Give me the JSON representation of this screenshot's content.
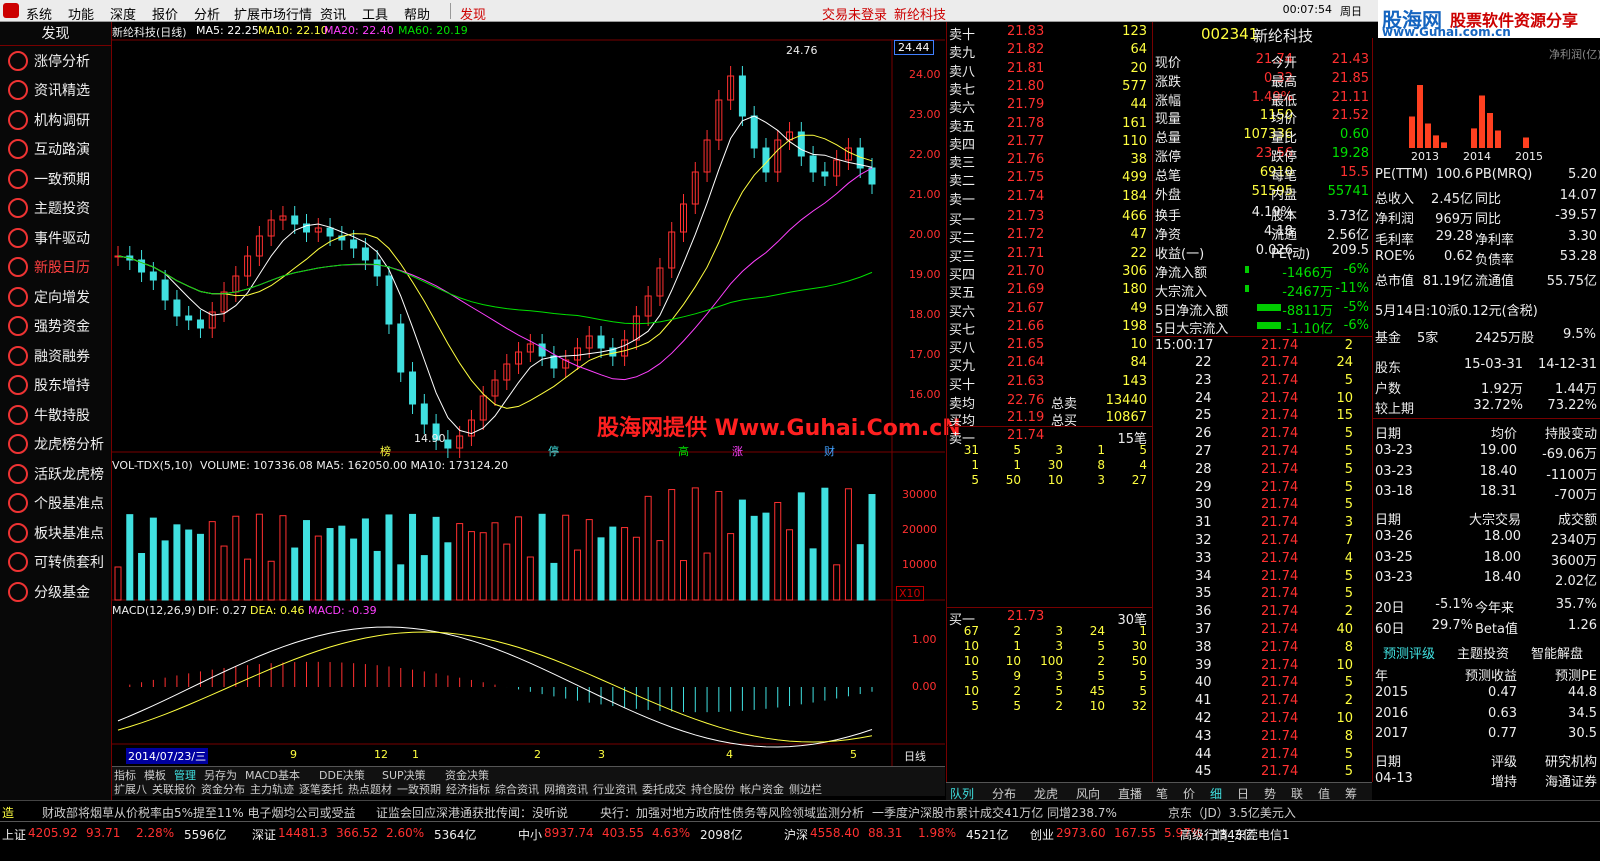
{
  "menu": [
    "系统",
    "功能",
    "深度",
    "报价",
    "分析",
    "扩展市场行情",
    "资讯",
    "工具",
    "帮助",
    "发现"
  ],
  "menu_status": {
    "login": "交易未登录",
    "stock": "新纶科技"
  },
  "clock": "00:07:54",
  "weekday": "周日",
  "brand": {
    "name": "股海网",
    "slogan": "股票软件资源分享",
    "url": "www.Guhai.com.cn"
  },
  "sidebar": {
    "header": "发现",
    "items": [
      "涨停分析",
      "资讯精选",
      "机构调研",
      "互动路演",
      "一致预期",
      "主题投资",
      "事件驱动",
      "新股日历",
      "定向增发",
      "强势资金",
      "融资融券",
      "股东增持",
      "牛散持股",
      "龙虎榜分析",
      "活跃龙虎榜",
      "个股基准点",
      "板块基准点",
      "可转债套利",
      "分级基金"
    ]
  },
  "chart": {
    "title": "新纶科技(日线)",
    "ma": [
      {
        "label": "MA5: 22.25",
        "color": "#ffffff"
      },
      {
        "label": "MA10: 22.10",
        "color": "#ffff40"
      },
      {
        "label": "MA20: 22.40",
        "color": "#ff40ff"
      },
      {
        "label": "MA60: 20.19",
        "color": "#00e000"
      }
    ],
    "price_axis": [
      "24.00",
      "23.00",
      "22.00",
      "21.00",
      "20.00",
      "19.00",
      "18.00",
      "17.00",
      "16.00"
    ],
    "current": "24.44",
    "high_label": "24.76",
    "low_label": "14.90",
    "markers": [
      {
        "t": "榜",
        "c": "#ffff40"
      },
      {
        "t": "停",
        "c": "#40e0e0"
      },
      {
        "t": "高",
        "c": "#00e000"
      },
      {
        "t": "涨",
        "c": "#ff40ff"
      },
      {
        "t": "财",
        "c": "#40a0ff"
      }
    ],
    "volume_title": "VOL-TDX(5,10)",
    "volume_values": "VOLUME: 107336.08  MA5: 162050.00  MA10: 173124.20",
    "vol_axis": [
      "30000",
      "20000",
      "10000"
    ],
    "vol_unit": "X10",
    "macd_title": "MACD(12,26,9)",
    "macd_dif": "DIF: 0.27",
    "macd_dea": "DEA: 0.46",
    "macd_val": "MACD: -0.39",
    "macd_axis": [
      "1.00",
      "0.00"
    ],
    "date_label": "2014/07/23/三",
    "x_ticks": [
      "9",
      "12",
      "1",
      "2",
      "3",
      "4",
      "5"
    ],
    "period": "日线",
    "zoom": [
      "+",
      "-",
      "0"
    ],
    "tabs": [
      "指标",
      "模板",
      "管理",
      "另存为",
      "MACD基本",
      "DDE决策",
      "SUP决策",
      "资金决策"
    ],
    "tabs2": [
      "扩展八",
      "关联报价",
      "资金分布",
      "主力轨迹",
      "逐笔委托",
      "热点题材",
      "一致预期",
      "经济指标",
      "综合资讯",
      "网摘资讯",
      "行业资讯",
      "委托成交",
      "持仓股份",
      "帐户资金",
      "侧边栏"
    ],
    "watermark": "股海网提供 Www.Guhai.Com.cN"
  },
  "orderbook": {
    "asks": [
      [
        "卖十",
        "21.83",
        "123"
      ],
      [
        "卖九",
        "21.82",
        "64"
      ],
      [
        "卖八",
        "21.81",
        "20"
      ],
      [
        "卖七",
        "21.80",
        "577"
      ],
      [
        "卖六",
        "21.79",
        "44"
      ],
      [
        "卖五",
        "21.78",
        "161"
      ],
      [
        "卖四",
        "21.77",
        "110"
      ],
      [
        "卖三",
        "21.76",
        "38"
      ],
      [
        "卖二",
        "21.75",
        "499"
      ],
      [
        "卖一",
        "21.74",
        "184"
      ]
    ],
    "bids": [
      [
        "买一",
        "21.73",
        "466"
      ],
      [
        "买二",
        "21.72",
        "47"
      ],
      [
        "买三",
        "21.71",
        "22"
      ],
      [
        "买四",
        "21.70",
        "306"
      ],
      [
        "买五",
        "21.69",
        "180"
      ],
      [
        "买六",
        "21.67",
        "49"
      ],
      [
        "买七",
        "21.66",
        "198"
      ],
      [
        "买八",
        "21.65",
        "10"
      ],
      [
        "买九",
        "21.64",
        "84"
      ],
      [
        "买十",
        "21.63",
        "143"
      ]
    ],
    "avg": [
      [
        "卖均",
        "22.76",
        "总卖",
        "13440"
      ],
      [
        "买均",
        "21.19",
        "总买",
        "10867"
      ]
    ],
    "sell1_detail": {
      "label": "卖一",
      "price": "21.74",
      "count": "15笔",
      "rows": [
        [
          "31",
          "5",
          "3",
          "1",
          "5"
        ],
        [
          "1",
          "1",
          "30",
          "8",
          "4"
        ],
        [
          "5",
          "50",
          "10",
          "3",
          "27"
        ]
      ]
    },
    "buy1_detail": {
      "label": "买一",
      "price": "21.73",
      "count": "30笔",
      "rows": [
        [
          "67",
          "2",
          "3",
          "24",
          "1"
        ],
        [
          "10",
          "1",
          "3",
          "5",
          "30"
        ],
        [
          "10",
          "10",
          "100",
          "2",
          "50"
        ],
        [
          "5",
          "9",
          "3",
          "5",
          "5"
        ],
        [
          "10",
          "2",
          "5",
          "45",
          "5"
        ],
        [
          "5",
          "5",
          "2",
          "10",
          "32"
        ]
      ]
    },
    "tabs": [
      "队列",
      "分布",
      "龙虎",
      "风向",
      "直播"
    ]
  },
  "quote": {
    "code": "002341",
    "name": "新纶科技",
    "rows": [
      [
        "现价",
        "21.74",
        "今开",
        "21.43"
      ],
      [
        "涨跌",
        "0.32",
        "最高",
        "21.85"
      ],
      [
        "涨幅",
        "1.49%",
        "最低",
        "21.11"
      ],
      [
        "现量",
        "1150",
        "均价",
        "21.52"
      ],
      [
        "总量",
        "107336",
        "量比",
        "0.60"
      ],
      [
        "涨停",
        "23.56",
        "跌停",
        "19.28"
      ],
      [
        "总笔",
        "6910",
        "每笔",
        "15.5"
      ],
      [
        "外盘",
        "51595",
        "内盘",
        "55741"
      ]
    ],
    "rows2": [
      [
        "换手",
        "4.19%",
        "股本",
        "3.73亿"
      ],
      [
        "净资",
        "4.18",
        "流通",
        "2.56亿"
      ],
      [
        "收益(一)",
        "0.026",
        "PE(动)",
        "209.5"
      ]
    ],
    "flows": [
      [
        "净流入额",
        "-1466万",
        "-6%"
      ],
      [
        "大宗流入",
        "-2467万",
        "-11%"
      ],
      [
        "5日净流入额",
        "-8811万",
        "-5%"
      ],
      [
        "5日大宗流入",
        "-1.10亿",
        "-6%"
      ]
    ]
  },
  "ticks": {
    "time": "15:00:17",
    "first": [
      "21.74",
      "2"
    ],
    "rows": [
      [
        "22",
        "21.74",
        "24"
      ],
      [
        "23",
        "21.74",
        "5"
      ],
      [
        "24",
        "21.74",
        "10"
      ],
      [
        "25",
        "21.74",
        "15"
      ],
      [
        "26",
        "21.74",
        "5"
      ],
      [
        "27",
        "21.74",
        "5"
      ],
      [
        "28",
        "21.74",
        "5"
      ],
      [
        "29",
        "21.74",
        "5"
      ],
      [
        "30",
        "21.74",
        "5"
      ],
      [
        "31",
        "21.74",
        "3"
      ],
      [
        "32",
        "21.74",
        "7"
      ],
      [
        "33",
        "21.74",
        "4"
      ],
      [
        "34",
        "21.74",
        "5"
      ],
      [
        "35",
        "21.74",
        "5"
      ],
      [
        "36",
        "21.74",
        "2"
      ],
      [
        "37",
        "21.74",
        "40"
      ],
      [
        "38",
        "21.74",
        "8"
      ],
      [
        "39",
        "21.74",
        "10"
      ],
      [
        "40",
        "21.74",
        "5"
      ],
      [
        "41",
        "21.74",
        "2"
      ],
      [
        "42",
        "21.74",
        "10"
      ],
      [
        "43",
        "21.74",
        "8"
      ],
      [
        "44",
        "21.74",
        "5"
      ],
      [
        "45",
        "21.74",
        "5"
      ]
    ],
    "tabs": [
      "笔",
      "价",
      "细",
      "日",
      "势",
      "联",
      "值",
      "筹"
    ]
  },
  "f10": {
    "chart_label": "净利润(亿)",
    "years": [
      "2013",
      "2014",
      "2015"
    ],
    "bars": [
      0.45,
      0.9,
      0.35,
      0.18,
      0.08,
      0.28,
      0.75,
      0.5,
      0.25,
      0.15
    ],
    "rows": [
      [
        "PE(TTM)",
        "100.6",
        "PB(MRQ)",
        "5.20"
      ],
      [
        "总收入",
        "2.45亿",
        "同比",
        "14.07"
      ],
      [
        "净利润",
        "969万",
        "同比",
        "-39.57"
      ],
      [
        "毛利率",
        "29.28",
        "净利率",
        "3.30"
      ],
      [
        "ROE%",
        "0.62",
        "负债率",
        "53.28"
      ],
      [
        "总市值",
        "81.19亿",
        "流通值",
        "55.75亿"
      ]
    ],
    "dividend": "5月14日:10派0.12元(含税)",
    "fund": [
      "基金",
      "5家",
      "2425万股",
      "9.5%"
    ],
    "holders": [
      [
        "股东",
        "15-03-31",
        "14-12-31"
      ],
      [
        "户数",
        "1.92万",
        "1.44万"
      ],
      [
        "较上期",
        "32.72%",
        "73.22%"
      ]
    ],
    "chip_head": [
      "日期",
      "均价",
      "持股变动"
    ],
    "chips": [
      [
        "03-23",
        "19.00",
        "-69.06万"
      ],
      [
        "03-23",
        "18.40",
        "-1100万"
      ],
      [
        "03-18",
        "18.31",
        "-700万"
      ]
    ],
    "block_head": [
      "日期",
      "大宗交易",
      "成交额"
    ],
    "blocks": [
      [
        "03-26",
        "18.00",
        "2340万"
      ],
      [
        "03-25",
        "18.00",
        "3600万"
      ],
      [
        "03-23",
        "18.40",
        "2.02亿"
      ]
    ],
    "perf": [
      [
        "20日",
        "-5.1%",
        "今年来",
        "35.7%"
      ],
      [
        "60日",
        "29.7%",
        "Beta值",
        "1.26"
      ]
    ],
    "tabs": [
      "预测评级",
      "主题投资",
      "智能解盘"
    ],
    "fc_head": [
      "年",
      "预测收益",
      "预测PE"
    ],
    "fc": [
      [
        "2015",
        "0.47",
        "44.8"
      ],
      [
        "2016",
        "0.63",
        "34.5"
      ],
      [
        "2017",
        "0.77",
        "30.5"
      ]
    ],
    "rate_head": [
      "日期",
      "评级",
      "研究机构"
    ],
    "rate": [
      [
        "04-13",
        "增持",
        "海通证券"
      ]
    ]
  },
  "ticker": [
    "造",
    "财政部将烟草从价税率由5%提至11% 电子烟均公司或受益",
    "证监会回应深港通获批传闻：没听说",
    "央行：加强对地方政府性债务等风险领域监测分析",
    "一季度沪深股市累计成交41万亿 同增238.7%",
    "京东（JD）3.5亿美元入"
  ],
  "status": [
    {
      "n": "上证",
      "v": "4205.92",
      "c": "93.71",
      "p": "2.28%",
      "a": "5596亿"
    },
    {
      "n": "深证",
      "v": "14481.3",
      "c": "366.52",
      "p": "2.60%",
      "a": "5364亿"
    },
    {
      "n": "中小",
      "v": "8937.74",
      "c": "403.55",
      "p": "4.63%",
      "a": "2098亿"
    },
    {
      "n": "沪深",
      "v": "4558.40",
      "c": "88.31",
      "p": "1.98%",
      "a": "4521亿"
    },
    {
      "n": "创业",
      "v": "2973.60",
      "c": "167.55",
      "p": "5.97%",
      "a": "1343亿"
    }
  ],
  "status_right": "高级行情_东莞电信1"
}
